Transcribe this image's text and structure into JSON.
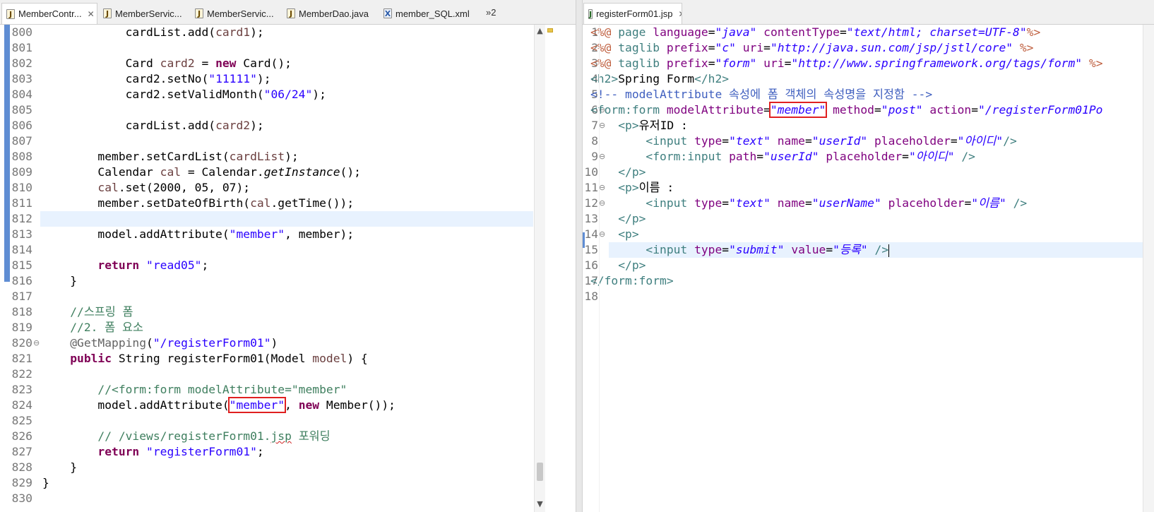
{
  "left_editor": {
    "tabs": [
      {
        "label": "MemberContr...",
        "icon": "java-file-icon",
        "active": true,
        "closable": true
      },
      {
        "label": "MemberServic...",
        "icon": "java-file-icon",
        "active": false
      },
      {
        "label": "MemberServic...",
        "icon": "java-file-icon",
        "active": false
      },
      {
        "label": "MemberDao.java",
        "icon": "java-file-icon",
        "active": false
      },
      {
        "label": "member_SQL.xml",
        "icon": "xml-file-icon",
        "active": false
      }
    ],
    "overflow_label": "»2",
    "current_line": 812,
    "lines": [
      {
        "n": "800",
        "t": [
          [
            "p",
            "            cardList.add("
          ],
          [
            "v",
            "card1"
          ],
          [
            "p",
            ");"
          ]
        ]
      },
      {
        "n": "801",
        "t": []
      },
      {
        "n": "802",
        "t": [
          [
            "p",
            "            Card "
          ],
          [
            "v",
            "card2"
          ],
          [
            "p",
            " = "
          ],
          [
            "k",
            "new"
          ],
          [
            "p",
            " Card();"
          ]
        ]
      },
      {
        "n": "803",
        "t": [
          [
            "p",
            "            card2.setNo("
          ],
          [
            "s",
            "\"11111\""
          ],
          [
            "p",
            ");"
          ]
        ]
      },
      {
        "n": "804",
        "t": [
          [
            "p",
            "            card2.setValidMonth("
          ],
          [
            "s",
            "\"06/24\""
          ],
          [
            "p",
            ");"
          ]
        ]
      },
      {
        "n": "805",
        "t": []
      },
      {
        "n": "806",
        "t": [
          [
            "p",
            "            cardList.add("
          ],
          [
            "v",
            "card2"
          ],
          [
            "p",
            ");"
          ]
        ]
      },
      {
        "n": "807",
        "t": []
      },
      {
        "n": "808",
        "t": [
          [
            "p",
            "        member.setCardList("
          ],
          [
            "v",
            "cardList"
          ],
          [
            "p",
            ");"
          ]
        ]
      },
      {
        "n": "809",
        "t": [
          [
            "p",
            "        Calendar "
          ],
          [
            "v",
            "cal"
          ],
          [
            "p",
            " = Calendar."
          ],
          [
            "i",
            "getInstance"
          ],
          [
            "p",
            "();"
          ]
        ]
      },
      {
        "n": "810",
        "t": [
          [
            "v",
            "        cal"
          ],
          [
            "p",
            ".set(2000, 05, 07);"
          ]
        ]
      },
      {
        "n": "811",
        "t": [
          [
            "p",
            "        member.setDateOfBirth("
          ],
          [
            "v",
            "cal"
          ],
          [
            "p",
            ".getTime());"
          ]
        ]
      },
      {
        "n": "812",
        "t": []
      },
      {
        "n": "813",
        "t": [
          [
            "p",
            "        model.addAttribute("
          ],
          [
            "s",
            "\"member\""
          ],
          [
            "p",
            ", member);"
          ]
        ]
      },
      {
        "n": "814",
        "t": []
      },
      {
        "n": "815",
        "t": [
          [
            "k",
            "        return"
          ],
          [
            "p",
            " "
          ],
          [
            "s",
            "\"read05\""
          ],
          [
            "p",
            ";"
          ]
        ]
      },
      {
        "n": "816",
        "t": [
          [
            "p",
            "    }"
          ]
        ]
      },
      {
        "n": "817",
        "t": []
      },
      {
        "n": "818",
        "t": [
          [
            "c",
            "    //스프링 폼"
          ]
        ]
      },
      {
        "n": "819",
        "t": [
          [
            "c",
            "    //2. 폼 요소"
          ]
        ]
      },
      {
        "n": "820",
        "fold": true,
        "t": [
          [
            "a",
            "    @GetMapping"
          ],
          [
            "p",
            "("
          ],
          [
            "s",
            "\"/registerForm01\""
          ],
          [
            "p",
            ")"
          ]
        ]
      },
      {
        "n": "821",
        "t": [
          [
            "k",
            "    public"
          ],
          [
            "p",
            " String registerForm01(Model "
          ],
          [
            "v",
            "model"
          ],
          [
            "p",
            ") {"
          ]
        ]
      },
      {
        "n": "822",
        "t": []
      },
      {
        "n": "823",
        "t": [
          [
            "c",
            "        //<form:form modelAttribute=\"member\""
          ]
        ]
      },
      {
        "n": "824",
        "t": [
          [
            "p",
            "        model.addAttribute("
          ],
          [
            "sb",
            "\"member\""
          ],
          [
            "p",
            ", "
          ],
          [
            "k",
            "new"
          ],
          [
            "p",
            " Member());"
          ]
        ]
      },
      {
        "n": "825",
        "t": []
      },
      {
        "n": "826",
        "t": [
          [
            "c",
            "        // /views/registerForm01."
          ],
          [
            "cq",
            "jsp"
          ],
          [
            "c",
            " 포워딩"
          ]
        ]
      },
      {
        "n": "827",
        "t": [
          [
            "k",
            "        return"
          ],
          [
            "p",
            " "
          ],
          [
            "s",
            "\"registerForm01\""
          ],
          [
            "p",
            ";"
          ]
        ]
      },
      {
        "n": "828",
        "t": [
          [
            "p",
            "    }"
          ]
        ]
      },
      {
        "n": "829",
        "t": [
          [
            "p",
            "}"
          ]
        ]
      },
      {
        "n": "830",
        "t": []
      }
    ]
  },
  "right_editor": {
    "tab": {
      "label": "registerForm01.jsp",
      "icon": "jsp-file-icon",
      "active": true,
      "closable": true
    },
    "current_line": 15,
    "lines": [
      {
        "n": "1",
        "t": [
          [
            "d",
            "<%@"
          ],
          [
            "p",
            " "
          ],
          [
            "tg",
            "page"
          ],
          [
            "p",
            " "
          ],
          [
            "at",
            "language"
          ],
          [
            "p",
            "="
          ],
          [
            "av",
            "\"java\""
          ],
          [
            "p",
            " "
          ],
          [
            "at",
            "contentType"
          ],
          [
            "p",
            "="
          ],
          [
            "av",
            "\"text/html; charset=UTF-8\""
          ],
          [
            "d",
            "%>"
          ]
        ]
      },
      {
        "n": "2",
        "t": [
          [
            "d",
            "<%@"
          ],
          [
            "p",
            " "
          ],
          [
            "tg",
            "taglib"
          ],
          [
            "p",
            " "
          ],
          [
            "at",
            "prefix"
          ],
          [
            "p",
            "="
          ],
          [
            "av",
            "\"c\""
          ],
          [
            "p",
            " "
          ],
          [
            "at",
            "uri"
          ],
          [
            "p",
            "="
          ],
          [
            "av",
            "\"http://java.sun.com/jsp/jstl/core\""
          ],
          [
            "p",
            " "
          ],
          [
            "d",
            "%>"
          ]
        ]
      },
      {
        "n": "3",
        "t": [
          [
            "d",
            "<%@"
          ],
          [
            "p",
            " "
          ],
          [
            "tg",
            "taglib"
          ],
          [
            "p",
            " "
          ],
          [
            "at",
            "prefix"
          ],
          [
            "p",
            "="
          ],
          [
            "av",
            "\"form\""
          ],
          [
            "p",
            " "
          ],
          [
            "at",
            "uri"
          ],
          [
            "p",
            "="
          ],
          [
            "av",
            "\"http://www.springframework.org/tags/form\""
          ],
          [
            "p",
            " "
          ],
          [
            "d",
            "%>"
          ]
        ]
      },
      {
        "n": "4",
        "t": [
          [
            "tg",
            "<h2>"
          ],
          [
            "p",
            "Spring Form"
          ],
          [
            "tg",
            "</h2>"
          ]
        ]
      },
      {
        "n": "5",
        "t": [
          [
            "hc",
            "<!-- modelAttribute 속성에 폼 객체의 속성명을 지정함 -->"
          ]
        ]
      },
      {
        "n": "6",
        "fold": true,
        "t": [
          [
            "tg",
            "<form:form"
          ],
          [
            "p",
            " "
          ],
          [
            "at",
            "modelAttribute"
          ],
          [
            "p",
            "="
          ],
          [
            "avb",
            "\"member\""
          ],
          [
            "p",
            " "
          ],
          [
            "at",
            "method"
          ],
          [
            "p",
            "="
          ],
          [
            "av",
            "\"post\""
          ],
          [
            "p",
            " "
          ],
          [
            "at",
            "action"
          ],
          [
            "p",
            "="
          ],
          [
            "av",
            "\"/registerForm01Po"
          ]
        ]
      },
      {
        "n": "7",
        "fold": true,
        "t": [
          [
            "p",
            "    "
          ],
          [
            "tg",
            "<p>"
          ],
          [
            "p",
            "유저ID :"
          ]
        ]
      },
      {
        "n": "8",
        "t": [
          [
            "p",
            "        "
          ],
          [
            "tg",
            "<input"
          ],
          [
            "p",
            " "
          ],
          [
            "at",
            "type"
          ],
          [
            "p",
            "="
          ],
          [
            "av",
            "\"text\""
          ],
          [
            "p",
            " "
          ],
          [
            "at",
            "name"
          ],
          [
            "p",
            "="
          ],
          [
            "av",
            "\"userId\""
          ],
          [
            "p",
            " "
          ],
          [
            "at",
            "placeholder"
          ],
          [
            "p",
            "="
          ],
          [
            "av",
            "\"아이디\""
          ],
          [
            "tg",
            "/>"
          ]
        ]
      },
      {
        "n": "9",
        "fold": true,
        "t": [
          [
            "p",
            "        "
          ],
          [
            "tg",
            "<form:input"
          ],
          [
            "p",
            " "
          ],
          [
            "at",
            "path"
          ],
          [
            "p",
            "="
          ],
          [
            "av",
            "\"userId\""
          ],
          [
            "p",
            " "
          ],
          [
            "at",
            "placeholder"
          ],
          [
            "p",
            "="
          ],
          [
            "av",
            "\"아이디\""
          ],
          [
            "p",
            " "
          ],
          [
            "tg",
            "/>"
          ]
        ]
      },
      {
        "n": "10",
        "t": [
          [
            "p",
            "    "
          ],
          [
            "tg",
            "</p>"
          ]
        ]
      },
      {
        "n": "11",
        "fold": true,
        "t": [
          [
            "p",
            "    "
          ],
          [
            "tg",
            "<p>"
          ],
          [
            "p",
            "이름 :"
          ]
        ]
      },
      {
        "n": "12",
        "fold": true,
        "t": [
          [
            "p",
            "        "
          ],
          [
            "tg",
            "<input"
          ],
          [
            "p",
            " "
          ],
          [
            "at",
            "type"
          ],
          [
            "p",
            "="
          ],
          [
            "av",
            "\"text\""
          ],
          [
            "p",
            " "
          ],
          [
            "at",
            "name"
          ],
          [
            "p",
            "="
          ],
          [
            "av",
            "\"userName\""
          ],
          [
            "p",
            " "
          ],
          [
            "at",
            "placeholder"
          ],
          [
            "p",
            "="
          ],
          [
            "av",
            "\"이름\""
          ],
          [
            "p",
            " "
          ],
          [
            "tg",
            "/>"
          ]
        ]
      },
      {
        "n": "13",
        "t": [
          [
            "p",
            "    "
          ],
          [
            "tg",
            "</p>"
          ]
        ]
      },
      {
        "n": "14",
        "fold": true,
        "t": [
          [
            "p",
            "    "
          ],
          [
            "tg",
            "<p>"
          ]
        ]
      },
      {
        "n": "15",
        "t": [
          [
            "p",
            "        "
          ],
          [
            "tg",
            "<input"
          ],
          [
            "p",
            " "
          ],
          [
            "at",
            "type"
          ],
          [
            "p",
            "="
          ],
          [
            "av",
            "\"submit\""
          ],
          [
            "p",
            " "
          ],
          [
            "at",
            "value"
          ],
          [
            "p",
            "="
          ],
          [
            "av",
            "\"등록\""
          ],
          [
            "p",
            " "
          ],
          [
            "tg",
            "/>"
          ],
          [
            "caret",
            ""
          ]
        ]
      },
      {
        "n": "16",
        "t": [
          [
            "p",
            "    "
          ],
          [
            "tg",
            "</p>"
          ]
        ]
      },
      {
        "n": "17",
        "t": [
          [
            "tg",
            "</form:form>"
          ]
        ]
      },
      {
        "n": "18",
        "t": []
      }
    ]
  },
  "icons": {
    "close": "close-icon",
    "fold": "fold-collapse-icon",
    "scroll_up": "scroll-up-icon",
    "scroll_down": "scroll-down-icon"
  },
  "colors": {
    "keyword": "#7f0055",
    "string": "#2a00ff",
    "comment": "#3f7f5f",
    "highlight_box": "#e02020",
    "current_line": "#e8f2fe"
  }
}
